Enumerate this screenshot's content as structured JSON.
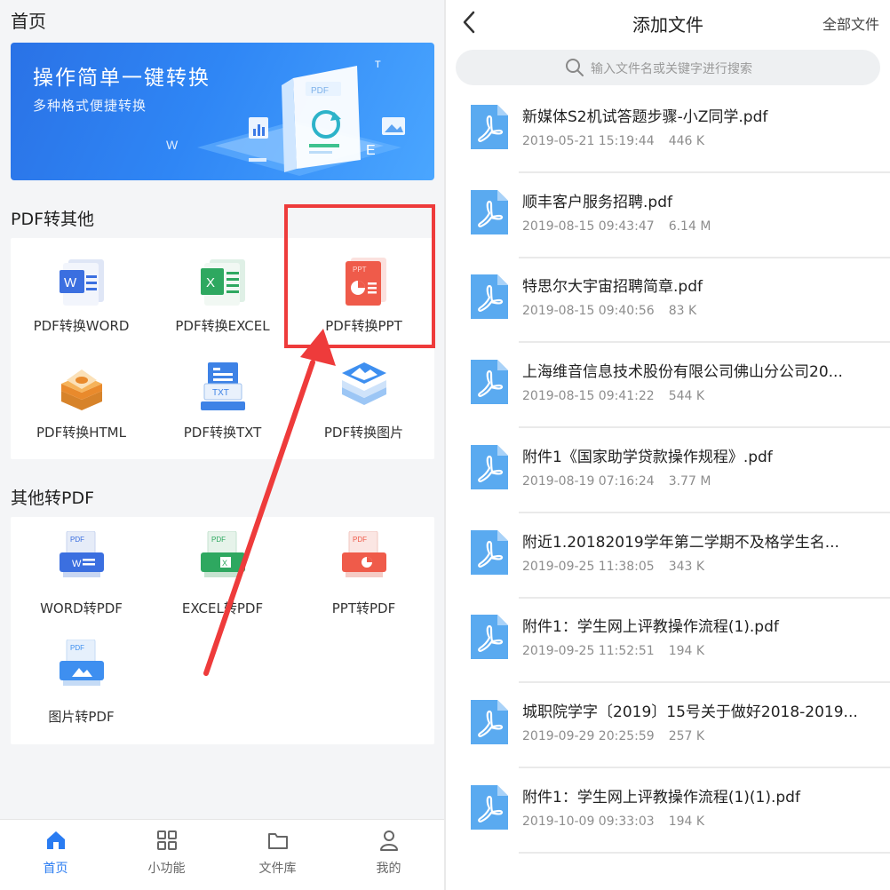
{
  "left": {
    "title": "首页",
    "banner": {
      "title": "操作简单一键转换",
      "subtitle": "多种格式便捷转换",
      "art_labels": {
        "doc": "PDF",
        "w": "W",
        "e": "E",
        "t": "T"
      }
    },
    "section_pdf_to_other": {
      "title": "PDF转其他",
      "tools": [
        {
          "label": "PDF转换WORD",
          "icon": "word-doc-icon",
          "color": "#3b6fe0"
        },
        {
          "label": "PDF转换EXCEL",
          "icon": "excel-doc-icon",
          "color": "#2ea860"
        },
        {
          "label": "PDF转换PPT",
          "icon": "ppt-doc-icon",
          "color": "#ef5b4a",
          "icon_text": "PPT"
        },
        {
          "label": "PDF转换HTML",
          "icon": "html-box-icon",
          "color": "#e98a2c"
        },
        {
          "label": "PDF转换TXT",
          "icon": "txt-doc-icon",
          "color": "#3d82e6",
          "icon_text": "TXT"
        },
        {
          "label": "PDF转换图片",
          "icon": "image-stack-icon",
          "color": "#3e8ff0"
        }
      ]
    },
    "section_other_to_pdf": {
      "title": "其他转PDF",
      "tools": [
        {
          "label": "WORD转PDF",
          "icon": "word-printer-icon",
          "color": "#3b6fe0",
          "icon_text": "PDF"
        },
        {
          "label": "EXCEL转PDF",
          "icon": "excel-printer-icon",
          "color": "#2ea860",
          "icon_text": "PDF"
        },
        {
          "label": "PPT转PDF",
          "icon": "ppt-printer-icon",
          "color": "#ef5b4a",
          "icon_text": "PDF"
        },
        {
          "label": "图片转PDF",
          "icon": "image-printer-icon",
          "color": "#3e8ff0",
          "icon_text": "PDF"
        }
      ]
    },
    "highlight_color": "#ee3b3b",
    "nav": [
      {
        "label": "首页",
        "icon": "home-icon",
        "active": true
      },
      {
        "label": "小功能",
        "icon": "grid-icon",
        "active": false
      },
      {
        "label": "文件库",
        "icon": "folder-icon",
        "active": false
      },
      {
        "label": "我的",
        "icon": "person-icon",
        "active": false
      }
    ],
    "accent": "#2a7cf2"
  },
  "right": {
    "title": "添加文件",
    "all_files": "全部文件",
    "search_placeholder": "输入文件名或关键字进行搜索",
    "files": [
      {
        "name": "新媒体S2机试答题步骤-小Z同学.pdf",
        "date": "2019-05-21 15:19:44",
        "size": "446 K"
      },
      {
        "name": "顺丰客户服务招聘.pdf",
        "date": "2019-08-15 09:43:47",
        "size": "6.14 M"
      },
      {
        "name": "特思尔大宇宙招聘简章.pdf",
        "date": "2019-08-15 09:40:56",
        "size": "83 K"
      },
      {
        "name": "上海维音信息技术股份有限公司佛山分公司20...",
        "date": "2019-08-15 09:41:22",
        "size": "544 K"
      },
      {
        "name": "附件1《国家助学贷款操作规程》.pdf",
        "date": "2019-08-19 07:16:24",
        "size": "3.77 M"
      },
      {
        "name": "附近1.20182019学年第二学期不及格学生名...",
        "date": "2019-09-25 11:38:05",
        "size": "343 K"
      },
      {
        "name": "附件1：学生网上评教操作流程(1).pdf",
        "date": "2019-09-25 11:52:51",
        "size": "194 K"
      },
      {
        "name": "城职院学字〔2019〕15号关于做好2018-2019...",
        "date": "2019-09-29 20:25:59",
        "size": "257 K"
      },
      {
        "name": "附件1：学生网上评教操作流程(1)(1).pdf",
        "date": "2019-10-09 09:33:03",
        "size": "194 K"
      }
    ],
    "file_icon": "pdf-file-icon",
    "file_icon_color": "#5aaaf0"
  }
}
